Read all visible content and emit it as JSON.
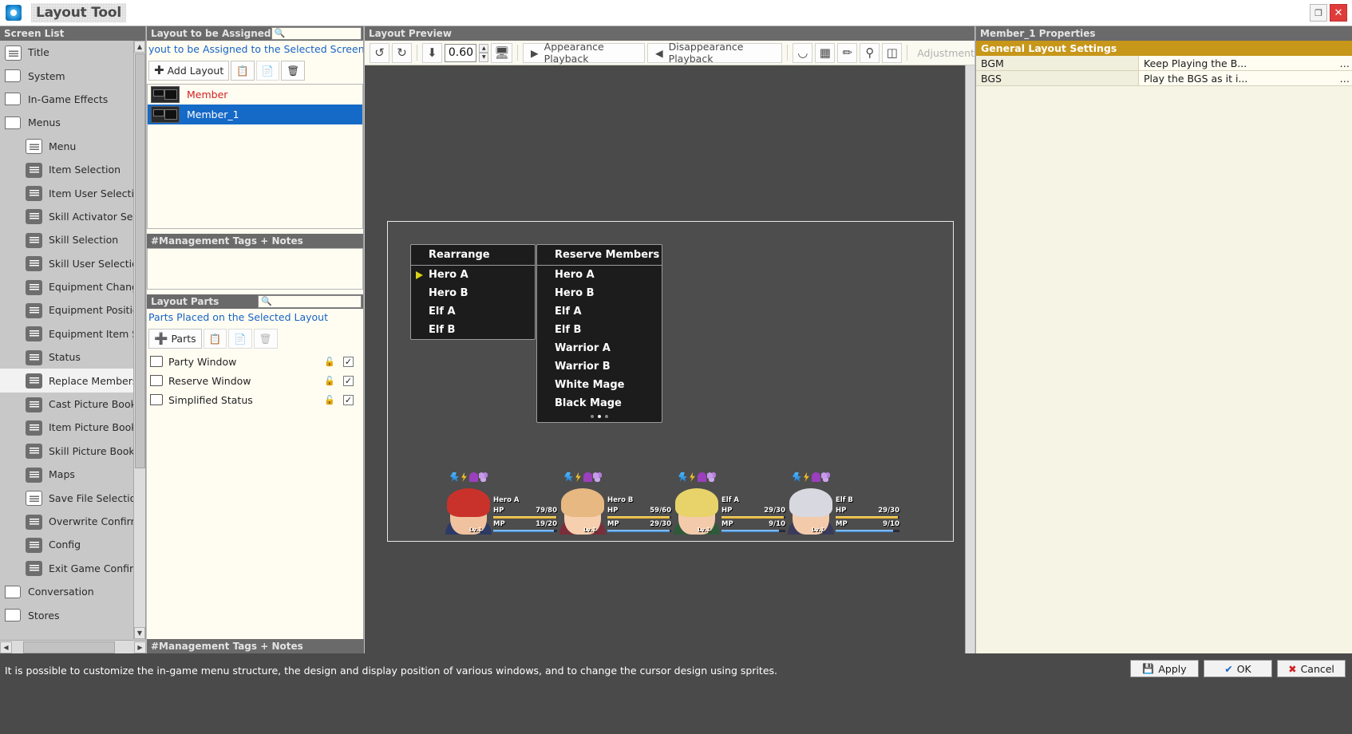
{
  "window": {
    "title": "Layout Tool",
    "app_icon": "layout-tool-icon",
    "maximize_label": "❐",
    "close_label": "✕"
  },
  "screen_list": {
    "header": "Screen List",
    "items": [
      {
        "label": "Title",
        "icon": "screen-icon",
        "indent": false,
        "selected": false,
        "light": true
      },
      {
        "label": "System",
        "icon": "folder-icon",
        "indent": false,
        "selected": false
      },
      {
        "label": "In-Game Effects",
        "icon": "folder-icon",
        "indent": false,
        "selected": false
      },
      {
        "label": "Menus",
        "icon": "folder-icon",
        "indent": false,
        "selected": false
      },
      {
        "label": "Menu",
        "icon": "screen-icon",
        "indent": true,
        "selected": false,
        "light": true
      },
      {
        "label": "Item Selection",
        "icon": "screen-icon",
        "indent": true,
        "selected": false
      },
      {
        "label": "Item User Selection",
        "icon": "screen-icon",
        "indent": true,
        "selected": false
      },
      {
        "label": "Skill Activator Selection",
        "icon": "screen-icon",
        "indent": true,
        "selected": false
      },
      {
        "label": "Skill Selection",
        "icon": "screen-icon",
        "indent": true,
        "selected": false
      },
      {
        "label": "Skill User Selection",
        "icon": "screen-icon",
        "indent": true,
        "selected": false
      },
      {
        "label": "Equipment Change",
        "icon": "screen-icon",
        "indent": true,
        "selected": false
      },
      {
        "label": "Equipment Position",
        "icon": "screen-icon",
        "indent": true,
        "selected": false
      },
      {
        "label": "Equipment Item Selection",
        "icon": "screen-icon",
        "indent": true,
        "selected": false
      },
      {
        "label": "Status",
        "icon": "screen-icon",
        "indent": true,
        "selected": false
      },
      {
        "label": "Replace Members",
        "icon": "screen-icon",
        "indent": true,
        "selected": true
      },
      {
        "label": "Cast Picture Book",
        "icon": "screen-icon",
        "indent": true,
        "selected": false
      },
      {
        "label": "Item Picture Book",
        "icon": "screen-icon",
        "indent": true,
        "selected": false
      },
      {
        "label": "Skill Picture Book",
        "icon": "screen-icon",
        "indent": true,
        "selected": false
      },
      {
        "label": "Maps",
        "icon": "screen-icon",
        "indent": true,
        "selected": false
      },
      {
        "label": "Save File Selection",
        "icon": "screen-icon",
        "indent": true,
        "selected": false,
        "light": true
      },
      {
        "label": "Overwrite Confirmation",
        "icon": "screen-icon",
        "indent": true,
        "selected": false
      },
      {
        "label": "Config",
        "icon": "screen-icon",
        "indent": true,
        "selected": false
      },
      {
        "label": "Exit Game Confirmation",
        "icon": "screen-icon",
        "indent": true,
        "selected": false
      },
      {
        "label": "Conversation",
        "icon": "folder-icon",
        "indent": false,
        "selected": false
      },
      {
        "label": "Stores",
        "icon": "folder-icon",
        "indent": false,
        "selected": false
      }
    ]
  },
  "assign_panel": {
    "header": "Layout to be Assigned",
    "search_placeholder": "",
    "note_link": "yout to be Assigned to the Selected Screen",
    "add_layout_label": "Add Layout",
    "copy_icon": "copy-icon",
    "paste_icon": "paste-icon",
    "delete_icon": "trash-icon",
    "layouts": [
      {
        "name": "Member",
        "selected": false
      },
      {
        "name": "Member_1",
        "selected": true
      }
    ],
    "tags_header": "#Management Tags + Notes",
    "parts_header": "Layout Parts",
    "parts_note": "Parts Placed on the Selected Layout",
    "parts_button_label": "Parts",
    "parts": [
      {
        "name": "Party Window",
        "locked": true,
        "checked": true
      },
      {
        "name": "Reserve Window",
        "locked": true,
        "checked": true
      },
      {
        "name": "Simplified Status",
        "locked": true,
        "checked": true
      }
    ],
    "bottom_tags_header": "#Management Tags + Notes"
  },
  "preview": {
    "header": "Layout Preview",
    "zoom_value": "0.60",
    "undo_icon": "redo-arrow-icon",
    "redo_icon": "undo-arrow-icon",
    "fit_icon": "fit-to-screen-icon",
    "monitor_icon": "monitor-icon",
    "appearance_label": "Appearance Playback",
    "disappearance_label": "Disappearance Playback",
    "magnet_icon": "magnet-icon",
    "grid_icon": "grid-icon",
    "ruler_icon": "ruler-icon",
    "anchor_icon": "anchor-point-icon",
    "layout_icon": "layout-boxes-icon",
    "adjustment_placeholder": "Adjustment",
    "game": {
      "rearrange_window": {
        "title": "Rearrange",
        "items": [
          "Hero A",
          "Hero B",
          "Elf A",
          "Elf B"
        ],
        "cursor_index": 0
      },
      "reserve_window": {
        "title": "Reserve Members",
        "items": [
          "Hero A",
          "Hero B",
          "Elf A",
          "Elf B",
          "Warrior A",
          "Warrior B",
          "White Mage",
          "Black Mage"
        ],
        "page_dots": 3,
        "active_dot": 1
      },
      "party": [
        {
          "name": "Hero A",
          "level": "Lv.1",
          "hp": "79/80",
          "mp": "19/20",
          "hp_pct": 99,
          "mp_pct": 95,
          "hair": "#c8322a",
          "skin": "#f0c2a0",
          "body": "#2b3a66"
        },
        {
          "name": "Hero B",
          "level": "Lv.1",
          "hp": "59/60",
          "mp": "29/30",
          "hp_pct": 98,
          "mp_pct": 97,
          "hair": "#e8b882",
          "skin": "#f5cfae",
          "body": "#7a2e3a"
        },
        {
          "name": "Elf A",
          "level": "Lv.1",
          "hp": "29/30",
          "mp": "9/10",
          "hp_pct": 97,
          "mp_pct": 90,
          "hair": "#e8d26a",
          "skin": "#f3cbab",
          "body": "#2f5a3a"
        },
        {
          "name": "Elf B",
          "level": "Lv.1",
          "hp": "29/30",
          "mp": "9/10",
          "hp_pct": 97,
          "mp_pct": 90,
          "hair": "#d8d8e0",
          "skin": "#f3cbab",
          "body": "#3a3a5a"
        }
      ],
      "status_icon_names": [
        "haste-icon",
        "power-up-icon",
        "poison-icon",
        "bubble-icon"
      ],
      "hp_label": "HP",
      "mp_label": "MP"
    }
  },
  "properties": {
    "header": "Member_1 Properties",
    "section": "General Layout Settings",
    "rows": [
      {
        "key": "BGM",
        "value": "Keep Playing the B..."
      },
      {
        "key": "BGS",
        "value": "Play the BGS as it i..."
      }
    ]
  },
  "bottom": {
    "status_message": "It is possible to customize the in-game menu structure, the design and display position of various windows, and to change the cursor design using sprites.",
    "apply_label": "Apply",
    "ok_label": "OK",
    "cancel_label": "Cancel"
  }
}
